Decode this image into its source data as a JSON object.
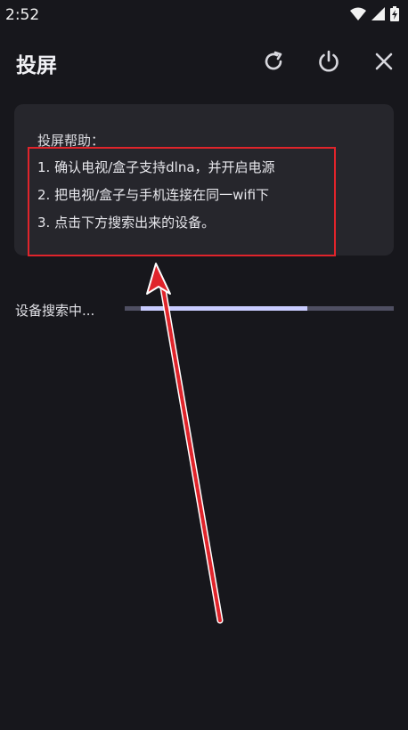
{
  "status_bar": {
    "time": "2:52",
    "icons": [
      "wifi-icon",
      "signal-icon",
      "battery-charging-icon"
    ]
  },
  "header": {
    "title": "投屏",
    "actions": [
      "refresh-icon",
      "power-icon",
      "close-icon"
    ]
  },
  "help": {
    "title": "投屏帮助：",
    "steps": [
      "1. 确认电视/盒子支持dlna，并开启电源",
      "2. 把电视/盒子与手机连接在同一wifi下",
      "3. 点击下方搜索出来的设备。"
    ]
  },
  "search": {
    "label": "设备搜索中...",
    "progress_start": 0.06,
    "progress_end": 0.68
  },
  "colors": {
    "background": "#17171c",
    "card": "#26262c",
    "highlight": "#e0242b",
    "progress_fill": "#c9ccff",
    "progress_track": "#4f4f62"
  }
}
